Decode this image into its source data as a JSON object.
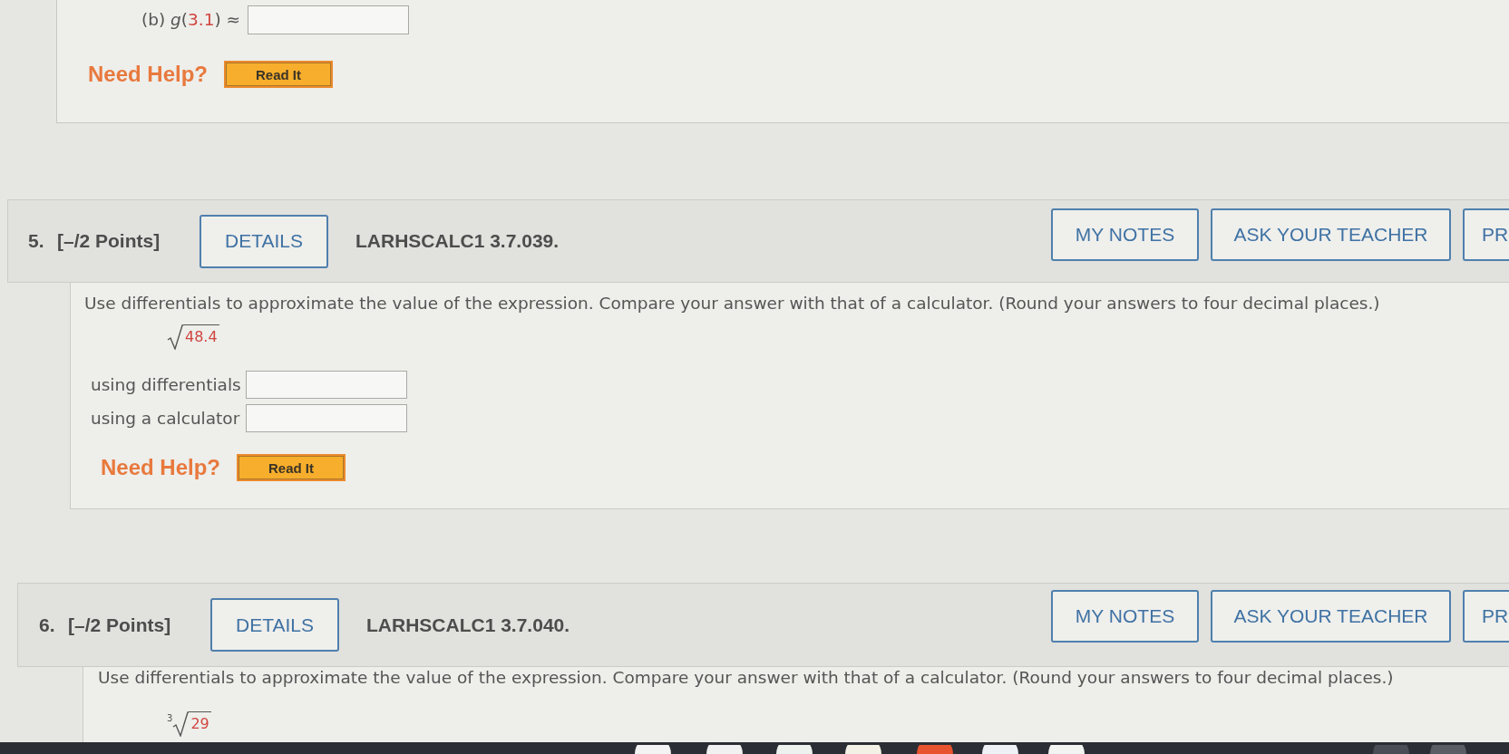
{
  "previous_question": {
    "prompt": [
      {
        "text": "(b) ",
        "kind": "text"
      },
      {
        "text": "g",
        "kind": "variable"
      },
      {
        "text": "(",
        "kind": "text"
      },
      {
        "text": "3.1",
        "kind": "number"
      },
      {
        "text": ") ≈",
        "kind": "text"
      }
    ],
    "need_help": {
      "label": "Need Help?",
      "button": "Read It"
    }
  },
  "questions": [
    {
      "number": "5.",
      "points": "[–/2 Points]",
      "details": "DETAILS",
      "code": "LARHSCALC1 3.7.039.",
      "actions": [
        {
          "label": "MY NOTES",
          "kind": "full"
        },
        {
          "label": "ASK YOUR TEACHER",
          "kind": "full"
        },
        {
          "label": "PR",
          "kind": "cut"
        }
      ],
      "instructions": "Use differentials to approximate the value of the expression. Compare your answer with that of a calculator. (Round your answers to four decimal places.)",
      "expression": {
        "radicand": "48.4"
      },
      "answers": [
        {
          "label": "using differentials"
        },
        {
          "label": "using a calculator"
        }
      ],
      "need_help": {
        "label": "Need Help?",
        "button": "Read It"
      }
    },
    {
      "number": "6.",
      "points": "[–/2 Points]",
      "details": "DETAILS",
      "code": "LARHSCALC1 3.7.040.",
      "actions": [
        {
          "label": "MY NOTES",
          "kind": "full"
        },
        {
          "label": "ASK YOUR TEACHER",
          "kind": "full"
        },
        {
          "label": "PR",
          "kind": "cut"
        }
      ],
      "instructions": "Use differentials to approximate the value of the expression. Compare your answer with that of a calculator. (Round your answers to four decimal places.)",
      "expression": {
        "index": "3",
        "radicand": "29"
      }
    }
  ]
}
